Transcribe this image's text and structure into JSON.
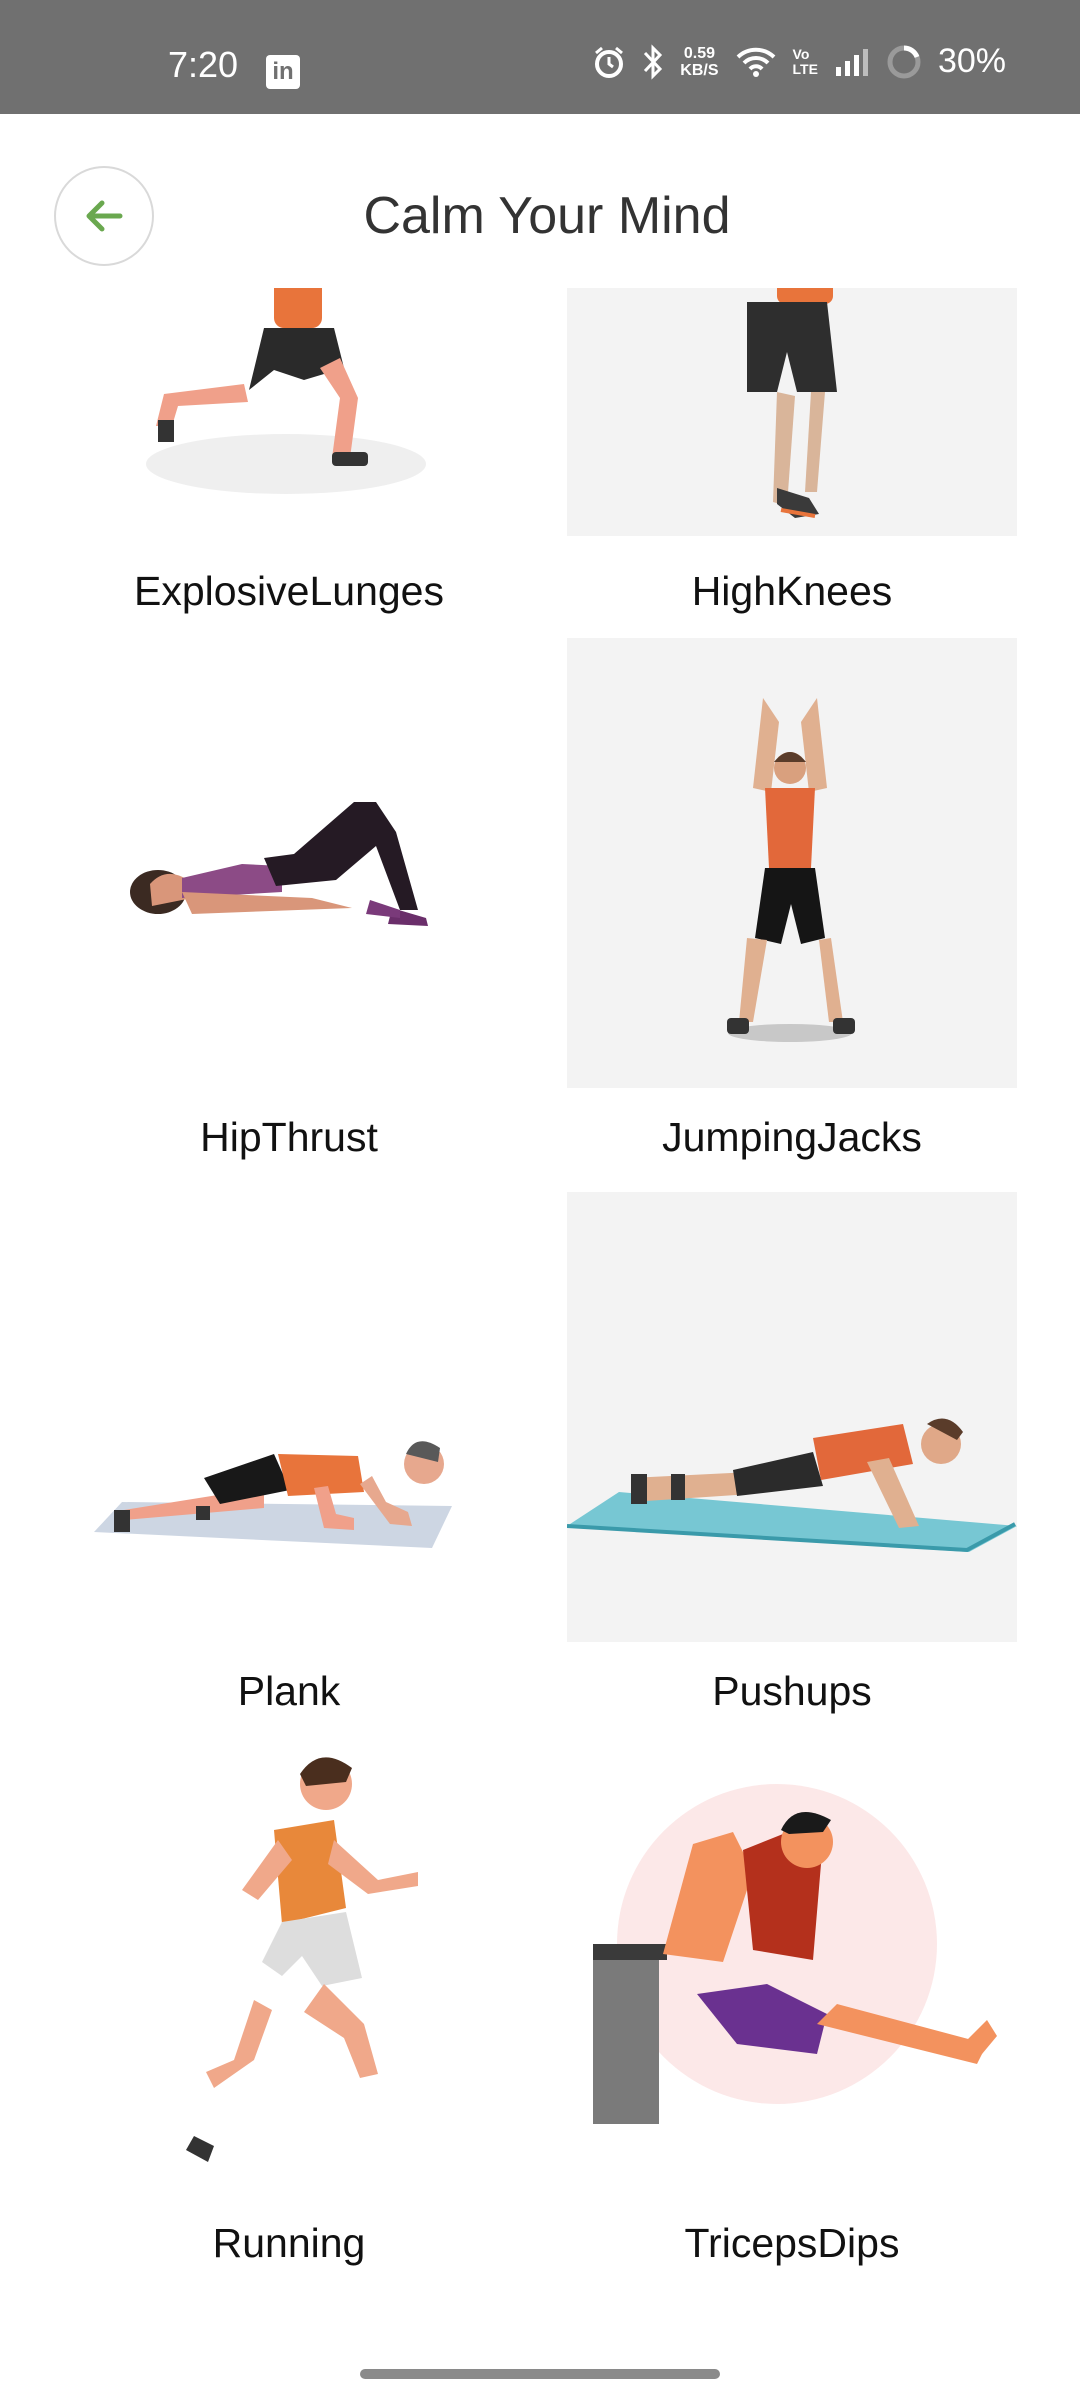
{
  "status_bar": {
    "time": "7:20",
    "net_speed_value": "0.59",
    "net_speed_unit": "KB/S",
    "volte_top": "Vo",
    "volte_bottom": "LTE",
    "battery": "30%",
    "icons": [
      "linkedin-icon",
      "alarm-icon",
      "bluetooth-icon",
      "wifi-icon",
      "signal-icon",
      "battery-icon"
    ]
  },
  "header": {
    "title": "Calm Your Mind",
    "back_icon": "arrow-left-icon",
    "accent": "#6aa84f"
  },
  "exercises": [
    {
      "label": "ExplosiveLunges"
    },
    {
      "label": "HighKnees"
    },
    {
      "label": "HipThrust"
    },
    {
      "label": "JumpingJacks"
    },
    {
      "label": "Plank"
    },
    {
      "label": "Pushups"
    },
    {
      "label": "Running"
    },
    {
      "label": "TricepsDips"
    }
  ]
}
